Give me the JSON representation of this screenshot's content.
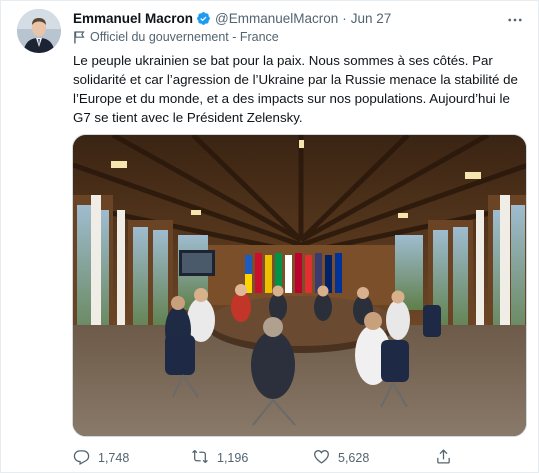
{
  "tweet": {
    "author_name": "Emmanuel Macron",
    "handle": "@EmmanuelMacron",
    "separator": "·",
    "date": "Jun 27",
    "affiliation": "Officiel du gouvernement - France",
    "text": "Le peuple ukrainien se bat pour la paix. Nous sommes à ses côtés. Par solidarité et car l’agression de l’Ukraine par la Russie menace la stabilité de l’Europe et du monde, et a des impacts sur nos populations. Aujourd’hui le G7 se tient avec le Président Zelensky.",
    "verified": true
  },
  "actions": {
    "replies": "1,748",
    "retweets": "1,196",
    "likes": "5,628"
  },
  "icons": {
    "verified": "verified-badge-icon",
    "more": "more-options-icon",
    "affiliation": "government-flag-icon",
    "reply": "reply-icon",
    "retweet": "retweet-icon",
    "like": "like-icon",
    "share": "share-icon"
  },
  "colors": {
    "accent": "#1d9bf0",
    "muted": "#536471",
    "text": "#0f1419"
  }
}
